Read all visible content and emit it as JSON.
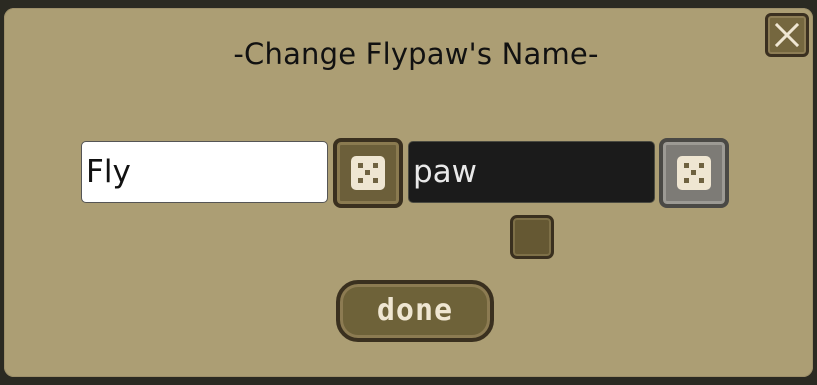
{
  "dialog": {
    "title": "-Change Flypaw's Name-",
    "prefix_value": "Fly",
    "suffix_value": "paw",
    "done_label": "done",
    "close_icon": "close-icon",
    "dice_icon": "dice-icon",
    "prefix_randomize_enabled": true,
    "suffix_randomize_enabled": false
  },
  "colors": {
    "panel": "#ac9e74",
    "button_fill": "#6e6239",
    "button_border": "#3a301f",
    "die_face": "#efe6d2",
    "disabled_button": "#7d7b76",
    "dark_input": "#1b1b1b"
  }
}
